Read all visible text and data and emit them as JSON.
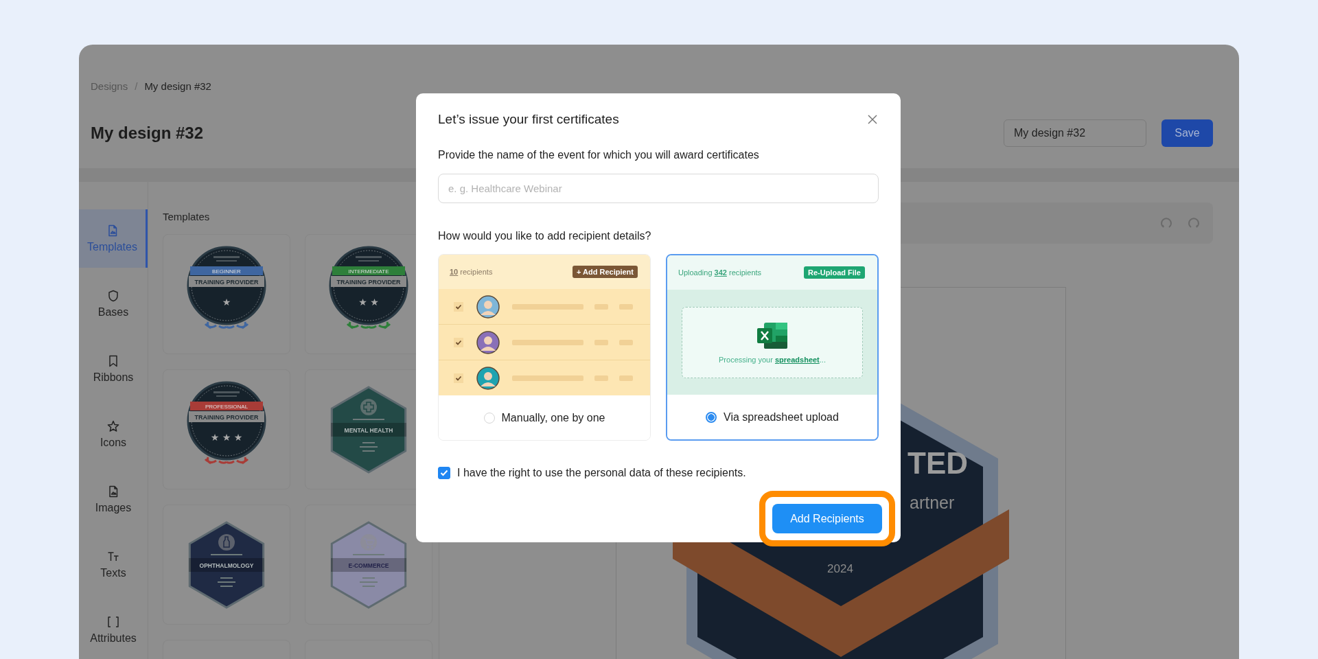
{
  "breadcrumb": {
    "separator": "/",
    "items": [
      {
        "label": "Designs"
      },
      {
        "label": "My design #32"
      }
    ]
  },
  "page_title": "My design #32",
  "name_field": {
    "value": "My design #32"
  },
  "save_button": "Save",
  "sidebar": {
    "items": [
      {
        "label": "Templates",
        "selected": true
      },
      {
        "label": "Bases",
        "selected": false
      },
      {
        "label": "Ribbons",
        "selected": false
      },
      {
        "label": "Icons",
        "selected": false
      },
      {
        "label": "Images",
        "selected": false
      },
      {
        "label": "Texts",
        "selected": false
      },
      {
        "label": "Attributes",
        "selected": false
      }
    ]
  },
  "templates": {
    "title": "Templates",
    "cards": [
      {
        "kind": "circle",
        "tier": "BEGINNER",
        "title": "TRAINING PROVIDER",
        "color": "#3f66a0",
        "star_glyphs": "★"
      },
      {
        "kind": "circle",
        "tier": "INTERMEDIATE",
        "title": "TRAINING PROVIDER",
        "color": "#2e7f3a",
        "star_glyphs": "★ ★"
      },
      {
        "kind": "circle",
        "tier": "PROFESSIONAL",
        "title": "TRAINING PROVIDER",
        "color": "#a83c37",
        "star_glyphs": "★ ★ ★"
      },
      {
        "kind": "hexagon",
        "title": "MENTAL HEALTH",
        "color": "#234a47"
      },
      {
        "kind": "hexagon",
        "title": "OPHTHALMOLOGY",
        "color": "#1f2a44"
      },
      {
        "kind": "hexagon",
        "title": "E-COMMERCE",
        "color": "#8a8aa6"
      },
      {
        "kind": "blank"
      },
      {
        "kind": "blank"
      }
    ]
  },
  "canvas": {
    "badge_texts": [
      "TED",
      "artner",
      "2024"
    ]
  },
  "dialog": {
    "title": "Let’s issue your first certificates",
    "event_label": "Provide the name of the event for which you will award certificates",
    "event_field": {
      "placeholder": "e. g. Healthcare Webinar"
    },
    "question": "How would you like to add recipient details?",
    "options": [
      {
        "kind": "manual",
        "selected": false,
        "label": "Manually, one by one",
        "header": "**10** recipients",
        "action": "+ Add Recipient",
        "rows": [
          {
            "checked": true,
            "color": "#7fb6d8"
          },
          {
            "checked": true,
            "color": "#8a70b8"
          },
          {
            "checked": true,
            "color": "#1fa3b0"
          }
        ]
      },
      {
        "kind": "spreadsheet",
        "selected": true,
        "label": "Via spreadsheet upload",
        "header": "Uploading **342** recipients",
        "action": "Re-Upload File",
        "status": "Processing your **spreadsheet**..."
      }
    ],
    "consent": {
      "checked": true,
      "label": "I have the right to use the personal data of these recipients."
    },
    "submit_button": "Add Recipients",
    "highlighted": true
  }
}
